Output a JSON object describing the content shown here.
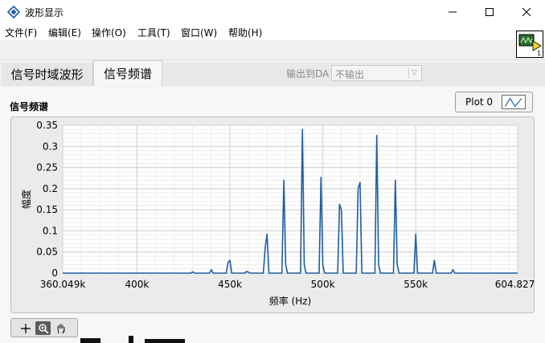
{
  "window": {
    "title": "波形显示",
    "icons": {
      "app": "labview-diamond-icon",
      "minimize": "minimize-icon",
      "maximize": "maximize-icon",
      "close": "close-icon"
    }
  },
  "menu": [
    "文件(F)",
    "编辑(E)",
    "操作(O)",
    "工具(T)",
    "窗口(W)",
    "帮助(H)"
  ],
  "vi_icon": {
    "number": "1"
  },
  "tabs": [
    {
      "label": "信号时域波形",
      "selected": false
    },
    {
      "label": "信号频谱",
      "selected": true
    }
  ],
  "da_output": {
    "label": "输出到DA",
    "value": "不输出",
    "icon": "chevron-down-icon"
  },
  "graph": {
    "caption": "信号频谱",
    "legend_label": "Plot 0",
    "palette_icons": [
      "cursor-move-icon",
      "zoom-icon",
      "pan-hand-icon"
    ]
  },
  "chart_data": {
    "type": "line",
    "title": "",
    "xlabel": "频率 (Hz)",
    "ylabel": "幅度",
    "xlim": [
      360049,
      604827
    ],
    "ylim": [
      0,
      0.35
    ],
    "x_tick_values": [
      360049,
      400000,
      450000,
      500000,
      550000,
      604827
    ],
    "x_tick_labels": [
      "360.049k",
      "400k",
      "450k",
      "500k",
      "550k",
      "604.827k"
    ],
    "y_tick_values": [
      0,
      0.05,
      0.1,
      0.15,
      0.2,
      0.25,
      0.3,
      0.35
    ],
    "y_tick_labels": [
      "0",
      "0.05",
      "0.1",
      "0.15",
      "0.2",
      "0.25",
      "0.3",
      "0.35"
    ],
    "grid": true,
    "line_color": "#1f5fa0",
    "series": [
      {
        "name": "Plot 0",
        "x": [
          360049,
          429000,
          430000,
          431000,
          439000,
          440000,
          441000,
          448000,
          449000,
          450000,
          451000,
          458000,
          459000,
          460000,
          461000,
          468000,
          469000,
          470000,
          471000,
          478000,
          479000,
          480000,
          481000,
          488000,
          489000,
          490000,
          491000,
          498000,
          499000,
          500000,
          501000,
          508000,
          509000,
          510000,
          511000,
          518000,
          519000,
          520000,
          521000,
          528000,
          529000,
          530000,
          531000,
          538000,
          539000,
          540000,
          541000,
          549000,
          550000,
          551000,
          559000,
          560000,
          561000,
          569000,
          570000,
          571000,
          604827
        ],
        "y": [
          0,
          0,
          0.003,
          0,
          0,
          0.008,
          0,
          0,
          0.025,
          0.03,
          0,
          0,
          0.004,
          0.002,
          0,
          0,
          0.06,
          0.092,
          0,
          0,
          0.22,
          0.02,
          0,
          0,
          0.34,
          0.02,
          0,
          0,
          0.227,
          0.02,
          0,
          0,
          0.163,
          0.15,
          0,
          0,
          0.2,
          0.215,
          0,
          0,
          0.326,
          0.02,
          0,
          0,
          0.22,
          0.02,
          0,
          0,
          0.092,
          0,
          0,
          0.03,
          0,
          0,
          0.008,
          0,
          0
        ]
      }
    ]
  }
}
